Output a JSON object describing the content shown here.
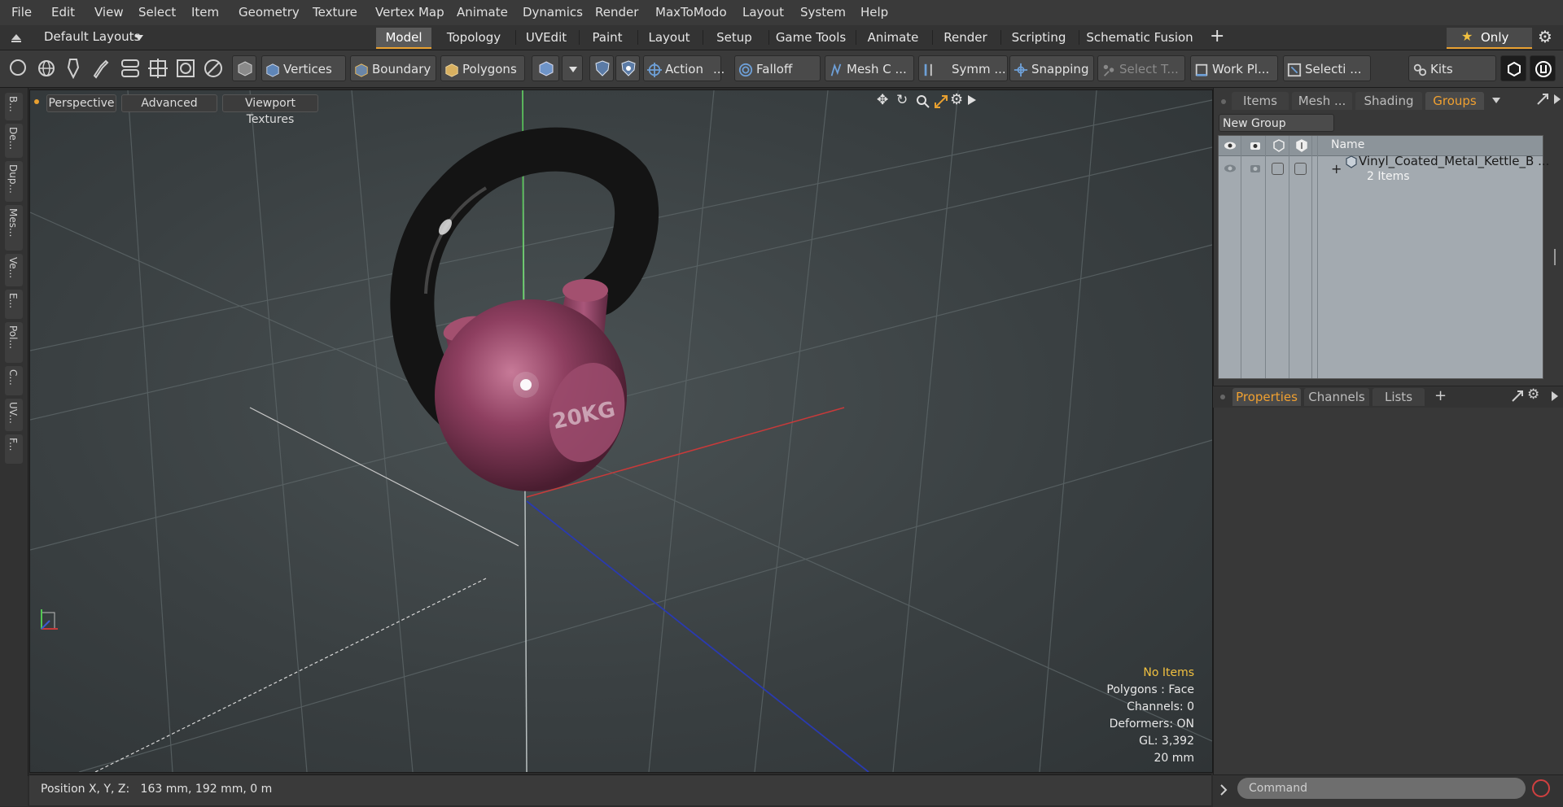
{
  "menu": [
    "File",
    "Edit",
    "View",
    "Select",
    "Item",
    "Geometry",
    "Texture",
    "Vertex Map",
    "Animate",
    "Dynamics",
    "Render",
    "MaxToModo",
    "Layout",
    "System",
    "Help"
  ],
  "layout_selector": "Default Layouts",
  "mode_tabs": [
    "Model",
    "Topology",
    "UVEdit",
    "Paint",
    "Layout",
    "Setup",
    "Game Tools",
    "Animate",
    "Render",
    "Scripting",
    "Schematic Fusion"
  ],
  "active_mode_tab": "Model",
  "only_label": "Only",
  "toolbar": {
    "vertices": "Vertices",
    "boundary": "Boundary",
    "polygons": "Polygons",
    "action": "Action",
    "falloff": "Falloff",
    "mesh_c": "Mesh C ...",
    "symm": "Symm ...",
    "snapping": "Snapping",
    "select_t": "Select T...",
    "work_pl": "Work Pl...",
    "selecti": "Selecti ...",
    "kits": "Kits"
  },
  "left_tabs": [
    "B...",
    "De...",
    "Dup...",
    "Mes...",
    "Ve...",
    "E...",
    "Pol...",
    "C...",
    "UV...",
    "F..."
  ],
  "viewport": {
    "buttons": [
      "Perspective",
      "Advanced",
      "Viewport Textures"
    ],
    "stats": {
      "selection": "No Items",
      "polygons": "Polygons : Face",
      "channels": "Channels: 0",
      "deformers": "Deformers: ON",
      "gl": "GL: 3,392",
      "scale": "20 mm"
    },
    "kettlebell_label": "20KG"
  },
  "status": {
    "position": "Position X, Y, Z:   163 mm, 192 mm, 0 m"
  },
  "right_tabs": [
    "Items",
    "Mesh ...",
    "Shading",
    "Groups"
  ],
  "active_right_tab": "Groups",
  "new_group": "New Group",
  "group_column": "Name",
  "group_item": {
    "name": "Vinyl_Coated_Metal_Kettle_B ...",
    "count": "2 Items"
  },
  "bottom_tabs": [
    "Properties",
    "Channels",
    "Lists"
  ],
  "active_bottom_tab": "Properties",
  "command_placeholder": "Command",
  "colors": {
    "accent": "#e8a030",
    "kettle": "#8e3f60",
    "handle": "#151515"
  }
}
